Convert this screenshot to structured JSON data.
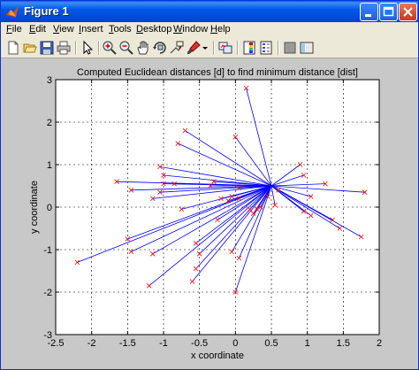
{
  "window": {
    "title": "Figure 1",
    "icon": "matlab-icon",
    "controls": [
      "minimize-icon",
      "maximize-icon",
      "close-icon"
    ]
  },
  "menu": [
    {
      "label": "File",
      "underline": "F",
      "rest": "ile"
    },
    {
      "label": "Edit",
      "underline": "E",
      "rest": "dit"
    },
    {
      "label": "View",
      "underline": "V",
      "rest": "iew"
    },
    {
      "label": "Insert",
      "underline": "I",
      "rest": "nsert"
    },
    {
      "label": "Tools",
      "underline": "T",
      "rest": "ools"
    },
    {
      "label": "Desktop",
      "underline": "D",
      "rest": "esktop"
    },
    {
      "label": "Window",
      "underline": "W",
      "rest": "indow"
    },
    {
      "label": "Help",
      "underline": "H",
      "rest": "elp"
    }
  ],
  "toolbar": [
    "new-figure-icon",
    "open-file-icon",
    "save-icon",
    "print-icon",
    "edit-plot-arrow-icon",
    "zoom-in-icon",
    "zoom-out-icon",
    "pan-hand-icon",
    "rotate-3d-icon",
    "data-cursor-icon",
    "brush-icon",
    "brush-dropdown-icon",
    "link-plot-icon",
    "insert-colorbar-icon",
    "insert-legend-icon",
    "hide-plot-tools-icon",
    "show-plot-tools-icon"
  ],
  "chart_data": {
    "type": "scatter",
    "title": "Computed Euclidean distances [d] to find minimum distance [dist]",
    "xlabel": "x coordinate",
    "ylabel": "y coordinate",
    "xlim": [
      -2.5,
      2
    ],
    "ylim": [
      -3,
      3
    ],
    "xticks": [
      "-2.5",
      "-2",
      "-1.5",
      "-1",
      "-0.5",
      "0",
      "0.5",
      "1",
      "1.5",
      "2"
    ],
    "yticks": [
      "-3",
      "-2",
      "-1",
      "0",
      "1",
      "2",
      "3"
    ],
    "grid": true,
    "grid_style": "dashed",
    "center": [
      0.5,
      0.5
    ],
    "marker": "x",
    "marker_color": "#ff0000",
    "line_color": "#0000ff",
    "points": [
      [
        -2.2,
        -1.3
      ],
      [
        -1.65,
        0.6
      ],
      [
        -1.45,
        0.4
      ],
      [
        -1.5,
        -0.75
      ],
      [
        -1.45,
        -1.05
      ],
      [
        -1.2,
        -1.85
      ],
      [
        -1.15,
        -1.1
      ],
      [
        -1.05,
        0.95
      ],
      [
        -1.0,
        0.75
      ],
      [
        -1.0,
        0.55
      ],
      [
        -1.05,
        0.35
      ],
      [
        -1.15,
        0.2
      ],
      [
        -0.85,
        0.55
      ],
      [
        -0.75,
        -0.05
      ],
      [
        -0.7,
        1.8
      ],
      [
        -0.8,
        1.5
      ],
      [
        -0.6,
        -1.75
      ],
      [
        -0.55,
        -0.85
      ],
      [
        -0.5,
        -1.1
      ],
      [
        -0.55,
        -1.45
      ],
      [
        -0.35,
        0.5
      ],
      [
        -0.3,
        0.6
      ],
      [
        -0.25,
        -0.3
      ],
      [
        -0.2,
        0.2
      ],
      [
        -0.1,
        0.15
      ],
      [
        -0.05,
        0.25
      ],
      [
        -0.05,
        -1.05
      ],
      [
        0.0,
        -2.0
      ],
      [
        0.0,
        1.65
      ],
      [
        0.05,
        0.45
      ],
      [
        0.05,
        0.2
      ],
      [
        0.05,
        -1.2
      ],
      [
        0.15,
        2.8
      ],
      [
        0.2,
        -0.05
      ],
      [
        0.25,
        -0.15
      ],
      [
        0.35,
        0.0
      ],
      [
        0.45,
        0.25
      ],
      [
        0.55,
        0.05
      ],
      [
        0.9,
        1.0
      ],
      [
        0.95,
        0.75
      ],
      [
        0.95,
        -0.1
      ],
      [
        1.05,
        0.25
      ],
      [
        1.05,
        -0.2
      ],
      [
        1.25,
        0.55
      ],
      [
        1.35,
        -0.3
      ],
      [
        1.45,
        -0.5
      ],
      [
        1.75,
        -0.7
      ],
      [
        1.8,
        0.35
      ],
      [
        0.6,
        0.4
      ],
      [
        0.3,
        -0.05
      ]
    ]
  }
}
